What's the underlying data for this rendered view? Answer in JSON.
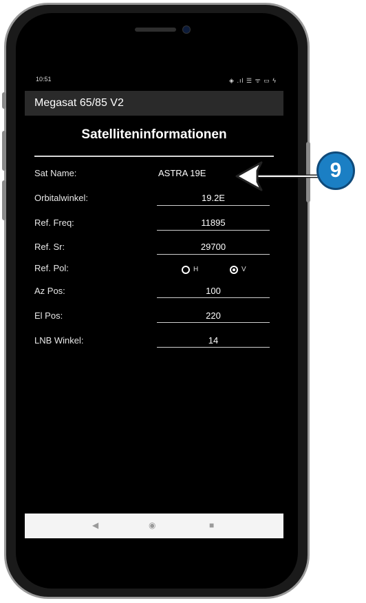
{
  "status_bar": {
    "time": "10:51",
    "right_icons": "◈ .ıl ☰ ᯤ ▭ ϟ"
  },
  "app_bar": {
    "title": "Megasat 65/85 V2"
  },
  "section": {
    "title": "Satelliteninformationen"
  },
  "fields": [
    {
      "label": "Sat Name:",
      "value": "ASTRA 19E"
    },
    {
      "label": "Orbitalwinkel:",
      "value": "19.2E"
    },
    {
      "label": "Ref. Freq:",
      "value": "11895"
    },
    {
      "label": "Ref. Sr:",
      "value": "29700"
    },
    {
      "label": "Ref. Pol:"
    },
    {
      "label": "Az Pos:",
      "value": "100"
    },
    {
      "label": "El Pos:",
      "value": "220"
    },
    {
      "label": "LNB Winkel:",
      "value": "14"
    }
  ],
  "polarization": {
    "options": [
      "H",
      "V"
    ],
    "selected": "V"
  },
  "nav": {
    "back": "◀",
    "home": "◉",
    "recents": "■"
  },
  "annotation": {
    "badge": "9"
  },
  "colors": {
    "badge": "#1b7fc4",
    "screen": "#000000",
    "app_bar": "#2a2a2a"
  }
}
